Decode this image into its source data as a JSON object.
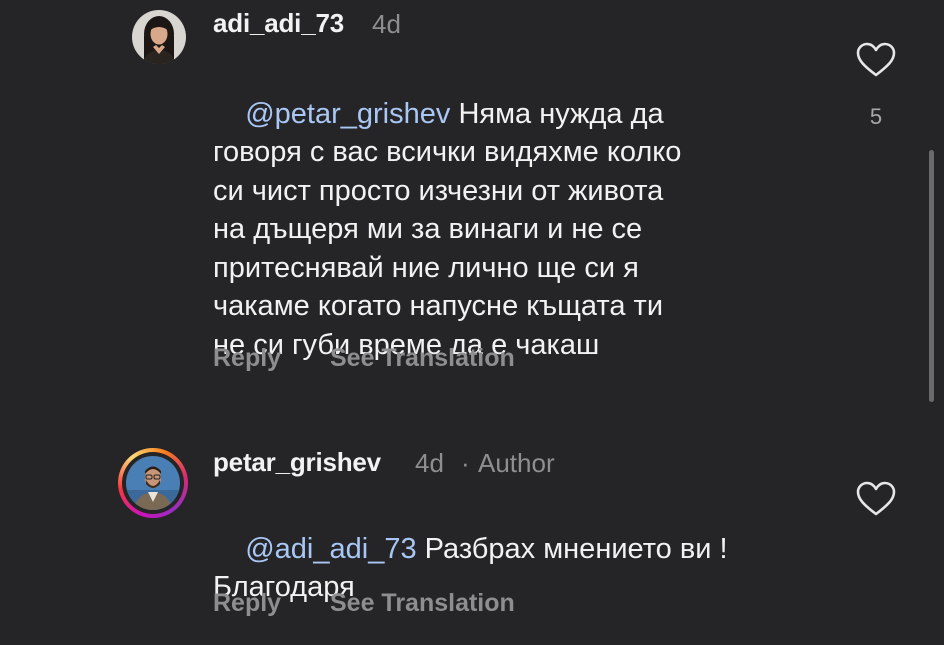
{
  "comments": [
    {
      "username": "adi_adi_73",
      "time": "4d",
      "author_label": "",
      "mention": "@petar_grishev",
      "text_lines": [
        "Няма нужда да",
        "говоря с вас всички видяхме колко",
        "си чист просто изчезни от живота",
        "на дъщеря ми за винаги и не се",
        "притеснявай ние лично ще си я",
        "чакаме когато напусне къщата ти",
        "не си губи време да е чакаш"
      ],
      "like_count": "5",
      "reply_label": "Reply",
      "translate_label": "See Translation",
      "avatar_icon": "profile-photo-woman",
      "heart_icon": "heart-outline-icon"
    },
    {
      "username": "petar_grishev",
      "time": "4d",
      "separator": "·",
      "author_label": "Author",
      "mention": "@adi_adi_73",
      "text_lines": [
        "Разбрах мнението ви !",
        "Благодаря"
      ],
      "like_count": "",
      "reply_label": "Reply",
      "translate_label": "See Translation",
      "avatar_icon": "profile-photo-man-with-story-ring",
      "heart_icon": "heart-outline-icon"
    }
  ],
  "colors": {
    "background": "#252527",
    "text": "#f2f2f2",
    "muted": "#8e8e90",
    "mention": "#a9c7f5"
  }
}
